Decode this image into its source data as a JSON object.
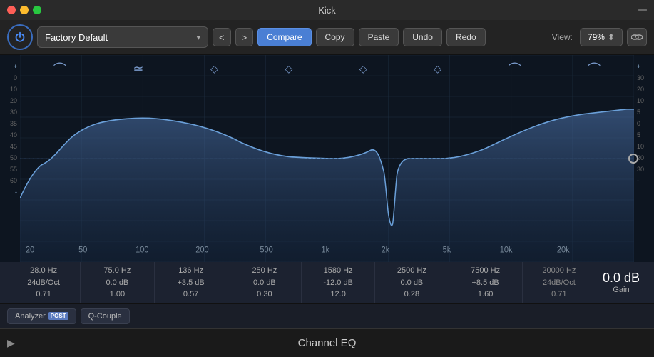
{
  "titleBar": {
    "title": "Kick",
    "dots": [
      "red",
      "yellow",
      "green"
    ]
  },
  "controls": {
    "presetName": "Factory Default",
    "compareLabel": "Compare",
    "copyLabel": "Copy",
    "pasteLabel": "Paste",
    "undoLabel": "Undo",
    "redoLabel": "Redo",
    "viewLabel": "View:",
    "viewPercent": "79%",
    "prevLabel": "<",
    "nextLabel": ">"
  },
  "freqLabels": [
    "20",
    "50",
    "100",
    "200",
    "500",
    "1k",
    "2k",
    "5k",
    "10k",
    "20k"
  ],
  "bandParams": [
    {
      "freq": "28.0 Hz",
      "gain": "24dB/Oct",
      "q": "0.71"
    },
    {
      "freq": "75.0 Hz",
      "gain": "0.0 dB",
      "q": "1.00"
    },
    {
      "freq": "136 Hz",
      "gain": "+3.5 dB",
      "q": "0.57"
    },
    {
      "freq": "250 Hz",
      "gain": "0.0 dB",
      "q": "0.30"
    },
    {
      "freq": "1580 Hz",
      "gain": "-12.0 dB",
      "q": "12.0"
    },
    {
      "freq": "2500 Hz",
      "gain": "0.0 dB",
      "q": "0.28"
    },
    {
      "freq": "7500 Hz",
      "gain": "+8.5 dB",
      "q": "1.60"
    },
    {
      "freq": "20000 Hz",
      "gain": "24dB/Oct",
      "q": "0.71"
    }
  ],
  "gainDisplay": {
    "label": "Gain",
    "value": "0.0 dB"
  },
  "bottomButtons": [
    {
      "label": "Analyzer",
      "badge": "POST"
    },
    {
      "label": "Q-Couple"
    }
  ],
  "footer": {
    "title": "Channel EQ"
  },
  "leftAxis": [
    "+",
    "0",
    "10",
    "20",
    "30",
    "35",
    "40",
    "45",
    "50",
    "55",
    "60",
    "-"
  ],
  "rightAxis": [
    "+",
    "30",
    "20",
    "10",
    "5",
    "0",
    "5",
    "10",
    "20",
    "30",
    "-"
  ]
}
